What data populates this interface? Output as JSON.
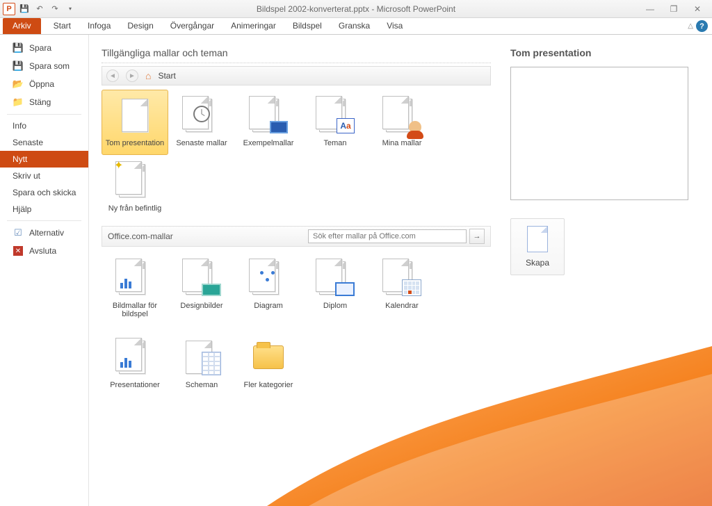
{
  "titlebar": {
    "title": "Bildspel 2002-konverterat.pptx - Microsoft PowerPoint",
    "app_letter": "P"
  },
  "tabs": {
    "file": "Arkiv",
    "items": [
      "Start",
      "Infoga",
      "Design",
      "Övergångar",
      "Animeringar",
      "Bildspel",
      "Granska",
      "Visa"
    ]
  },
  "sidebar": {
    "items": [
      {
        "label": "Spara",
        "icon": "disk"
      },
      {
        "label": "Spara som",
        "icon": "disk"
      },
      {
        "label": "Öppna",
        "icon": "folder"
      },
      {
        "label": "Stäng",
        "icon": "folder"
      },
      {
        "label": "Info",
        "icon": ""
      },
      {
        "label": "Senaste",
        "icon": ""
      },
      {
        "label": "Nytt",
        "icon": "",
        "selected": true
      },
      {
        "label": "Skriv ut",
        "icon": ""
      },
      {
        "label": "Spara och skicka",
        "icon": ""
      },
      {
        "label": "Hjälp",
        "icon": ""
      },
      {
        "label": "Alternativ",
        "icon": "opts"
      },
      {
        "label": "Avsluta",
        "icon": "exit"
      }
    ]
  },
  "templates": {
    "section_title": "Tillgängliga mallar och teman",
    "breadcrumb": "Start",
    "row1": [
      {
        "label": "Tom presentation",
        "selected": true
      },
      {
        "label": "Senaste mallar"
      },
      {
        "label": "Exempelmallar"
      },
      {
        "label": "Teman"
      },
      {
        "label": "Mina mallar"
      }
    ],
    "row2": [
      {
        "label": "Ny från befintlig"
      }
    ],
    "office_label": "Office.com-mallar",
    "search_placeholder": "Sök efter mallar på Office.com",
    "categories_row1": [
      {
        "label": "Bildmallar för bildspel"
      },
      {
        "label": "Designbilder"
      },
      {
        "label": "Diagram"
      },
      {
        "label": "Diplom"
      },
      {
        "label": "Kalendrar"
      }
    ],
    "categories_row2": [
      {
        "label": "Presentationer"
      },
      {
        "label": "Scheman"
      },
      {
        "label": "Fler kategorier"
      }
    ]
  },
  "preview": {
    "title": "Tom presentation",
    "create": "Skapa"
  }
}
